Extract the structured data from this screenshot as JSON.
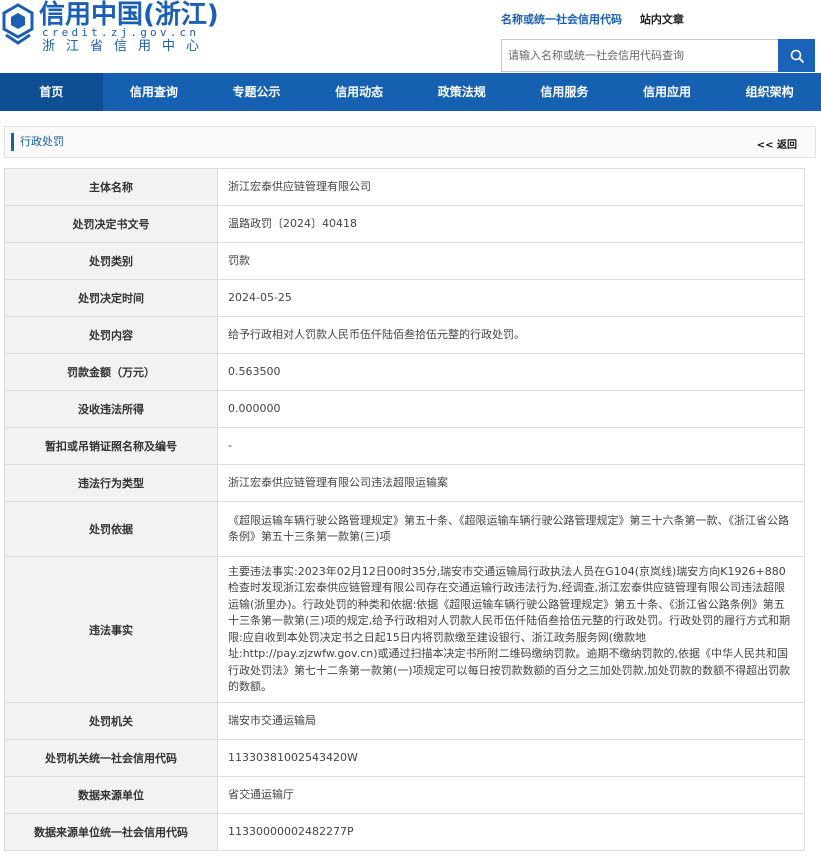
{
  "header": {
    "brand_title": "信用中国(浙江)",
    "brand_url": "credit.zj.gov.cn",
    "brand_sub": "浙江省信用中心",
    "search_tabs": [
      {
        "label": "名称或统一社会信用代码"
      },
      {
        "label": "站内文章"
      }
    ],
    "search_placeholder": "请输入名称或统一社会信用代码查询",
    "colors": {
      "brand": "#1a5fb4",
      "nav": "#1560b1"
    },
    "icons": {
      "logo": "credit-logo-icon",
      "search": "search-icon"
    }
  },
  "nav": {
    "items": [
      {
        "label": "首页"
      },
      {
        "label": "信用查询"
      },
      {
        "label": "专题公示"
      },
      {
        "label": "信用动态"
      },
      {
        "label": "政策法规"
      },
      {
        "label": "信用服务"
      },
      {
        "label": "信用应用"
      },
      {
        "label": "组织架构"
      }
    ]
  },
  "panel": {
    "title": "行政处罚",
    "back_label": "<< 返回"
  },
  "rows": [
    {
      "label": "主体名称",
      "value": "浙江宏泰供应链管理有限公司"
    },
    {
      "label": "处罚决定书文号",
      "value": "温路政罚〔2024〕40418"
    },
    {
      "label": "处罚类别",
      "value": "罚款"
    },
    {
      "label": "处罚决定时间",
      "value": "2024-05-25"
    },
    {
      "label": "处罚内容",
      "value": "给予行政相对人罚款人民币伍仟陆佰叁拾伍元整的行政处罚。"
    },
    {
      "label": "罚款金额（万元）",
      "value": "0.563500"
    },
    {
      "label": "没收违法所得",
      "value": "0.000000"
    },
    {
      "label": "暂扣或吊销证照名称及编号",
      "value": "-"
    },
    {
      "label": "违法行为类型",
      "value": "浙江宏泰供应链管理有限公司违法超限运输案"
    },
    {
      "label": "处罚依据",
      "value": "《超限运输车辆行驶公路管理规定》第五十条、《超限运输车辆行驶公路管理规定》第三十六条第一款、《浙江省公路条例》第五十三条第一款第(三)项"
    },
    {
      "label": "违法事实",
      "value": "主要违法事实:2023年02月12日00时35分,瑞安市交通运输局行政执法人员在G104(京岚线)瑞安方向K1926+880检查时发现浙江宏泰供应链管理有限公司存在交通运输行政违法行为,经调查,浙江宏泰供应链管理有限公司违法超限运输(浙里办)。行政处罚的种类和依据:依据《超限运输车辆行驶公路管理规定》第五十条、《浙江省公路条例》第五十三条第一款第(三)项的规定,给予行政相对人罚款人民币伍仟陆佰叁拾伍元整的行政处罚。行政处罚的履行方式和期限:应自收到本处罚决定书之日起15日内将罚款缴至建设银行、浙江政务服务网(缴款地址:http://pay.zjzwfw.gov.cn)或通过扫描本决定书所附二维码缴纳罚款。逾期不缴纳罚款的,依据《中华人民共和国行政处罚法》第七十二条第一款第(一)项规定可以每日按罚款数额的百分之三加处罚款,加处罚款的数额不得超出罚款的数额。"
    },
    {
      "label": "处罚机关",
      "value": "瑞安市交通运输局"
    },
    {
      "label": "处罚机关统一社会信用代码",
      "value": "11330381002543420W"
    },
    {
      "label": "数据来源单位",
      "value": "省交通运输厅"
    },
    {
      "label": "数据来源单位统一社会信用代码",
      "value": "11330000002482277P"
    }
  ]
}
